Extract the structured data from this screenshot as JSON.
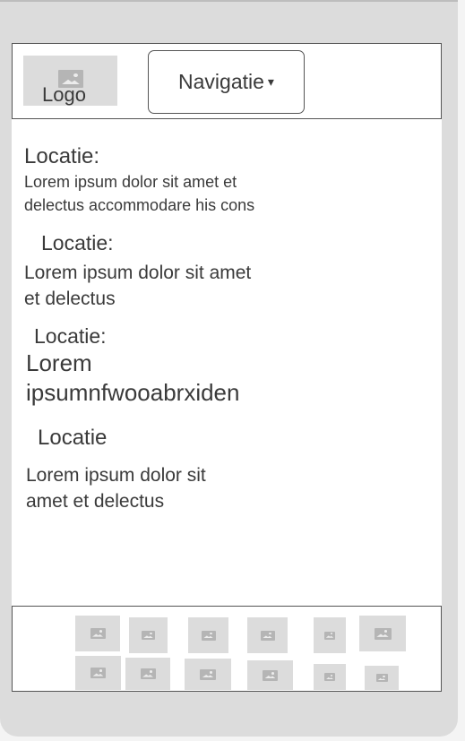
{
  "header": {
    "logo_label": "Logo",
    "nav_label": "Navigatie",
    "nav_caret": "▾"
  },
  "items": [
    {
      "title": "Locatie:",
      "text_lines": [
        "Lorem ipsum dolor sit amet et",
        "delectus accommodare his cons"
      ]
    },
    {
      "title": "Locatie:",
      "text_lines": [
        "Lorem ipsum dolor sit amet",
        "et delectus"
      ]
    },
    {
      "title": "Locatie:",
      "text_lines": [
        "Lorem",
        "ipsumnfwooabrxiden"
      ]
    },
    {
      "title": "Locatie",
      "text_lines": [
        "Lorem ipsum dolor sit",
        "amet et delectus"
      ]
    }
  ],
  "footer": {
    "image_placeholder_count": 12,
    "icon": "image-placeholder-icon"
  },
  "colors": {
    "device_frame": "#dcdcdc",
    "screen_bg": "#ffffff",
    "placeholder": "#dcdcdc",
    "text": "#3a3a3a",
    "border": "#555555"
  }
}
